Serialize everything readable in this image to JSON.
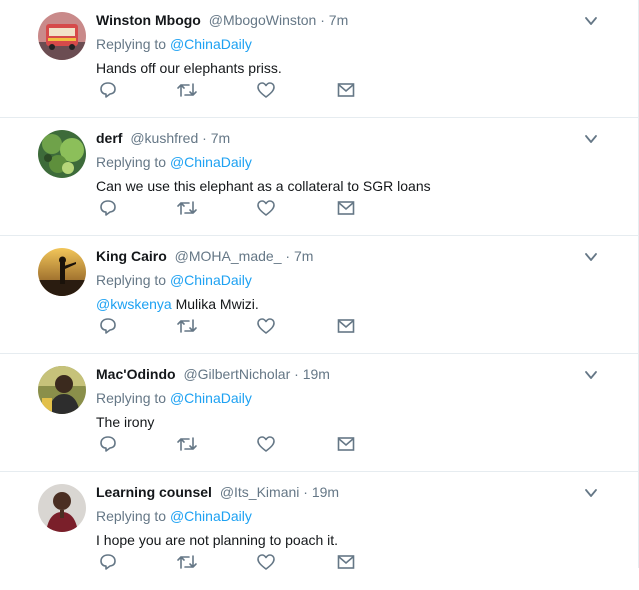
{
  "replying_prefix": "Replying to",
  "separator": "·",
  "colors": {
    "link": "#1da1f2",
    "secondary": "#657786",
    "icon": "#657786",
    "border": "#e6ecf0"
  },
  "icons": [
    "reply-icon",
    "retweet-icon",
    "like-icon",
    "direct-message-icon",
    "chevron-down-icon"
  ],
  "tweets": [
    {
      "name": "Winston Mbogo",
      "handle": "@MbogoWinston",
      "time": "7m",
      "reply_to": "@ChinaDaily",
      "mention": "",
      "text": "Hands off our elephants priss."
    },
    {
      "name": "derf",
      "handle": "@kushfred",
      "time": "7m",
      "reply_to": "@ChinaDaily",
      "mention": "",
      "text": "Can we use this elephant as a collateral to SGR loans"
    },
    {
      "name": "King Cairo",
      "handle": "@MOHA_made_",
      "time": "7m",
      "reply_to": "@ChinaDaily",
      "mention": "@kwskenya",
      "text": " Mulika Mwizi."
    },
    {
      "name": "Mac'Odindo",
      "handle": "@GilbertNicholar",
      "time": "19m",
      "reply_to": "@ChinaDaily",
      "mention": "",
      "text": "The irony"
    },
    {
      "name": "Learning counsel",
      "handle": "@Its_Kimani",
      "time": "19m",
      "reply_to": "@ChinaDaily",
      "mention": "",
      "text": "I hope you are not planning to poach it."
    }
  ]
}
